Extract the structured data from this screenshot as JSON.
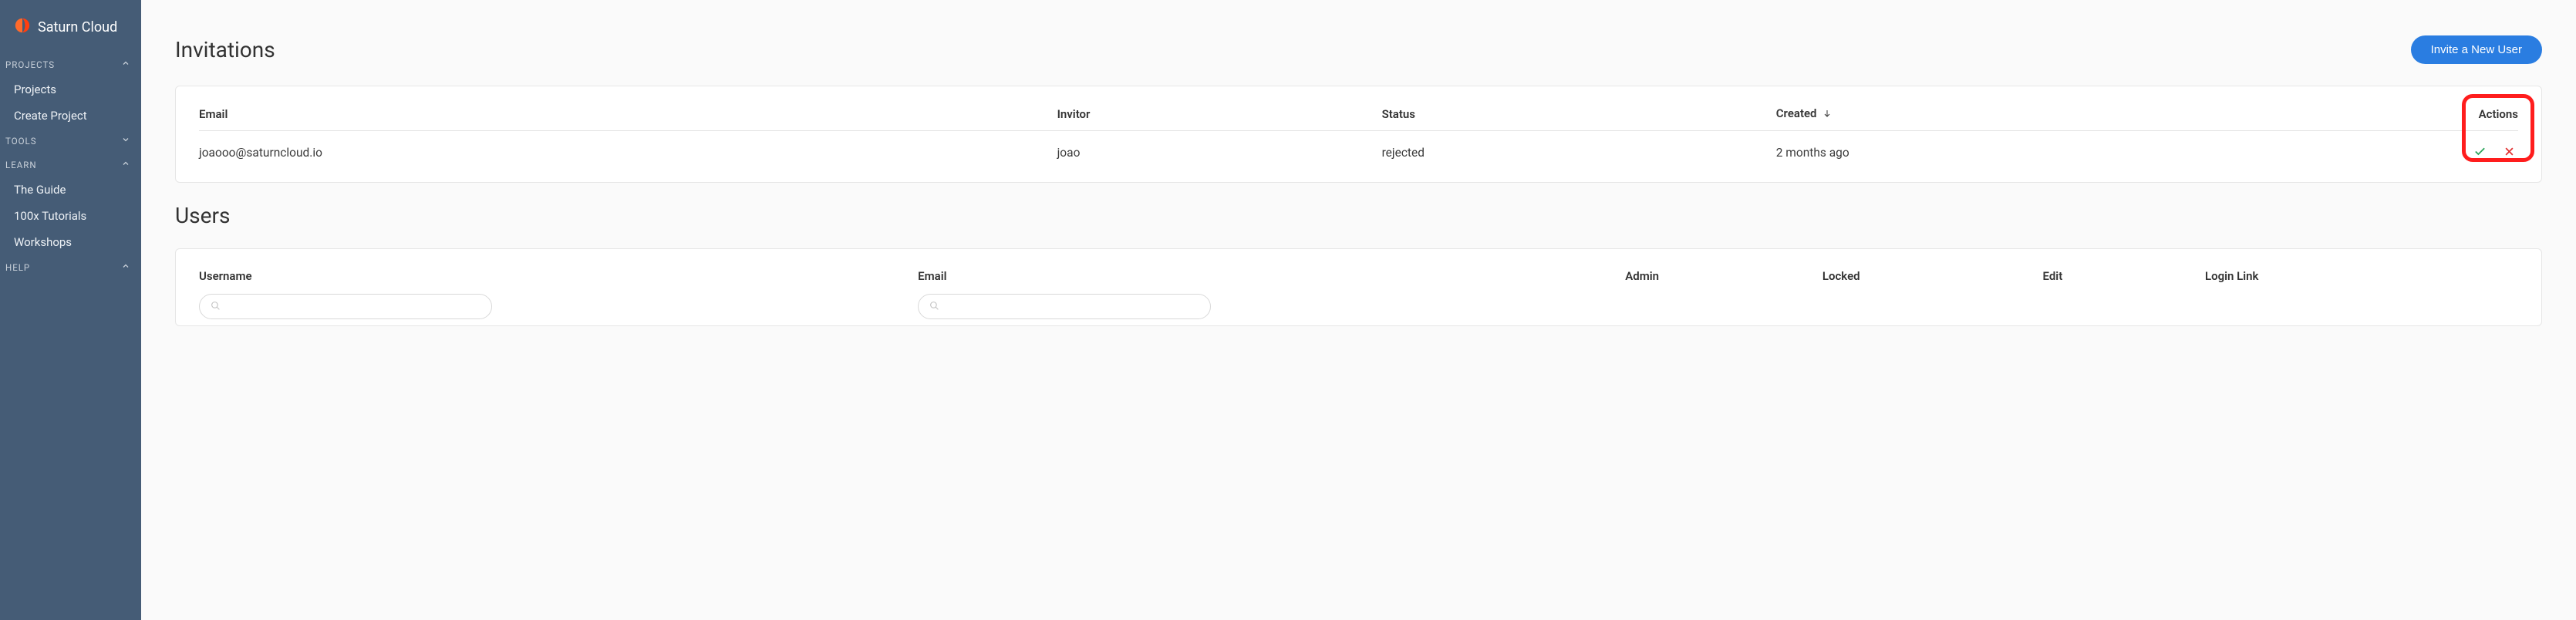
{
  "brand": {
    "name": "Saturn Cloud"
  },
  "sidebar": {
    "sections": [
      {
        "label": "PROJECTS",
        "expanded": true,
        "items": [
          {
            "label": "Projects"
          },
          {
            "label": "Create Project"
          }
        ]
      },
      {
        "label": "TOOLS",
        "expanded": false,
        "items": []
      },
      {
        "label": "LEARN",
        "expanded": true,
        "items": [
          {
            "label": "The Guide"
          },
          {
            "label": "100x Tutorials"
          },
          {
            "label": "Workshops"
          }
        ]
      },
      {
        "label": "HELP",
        "expanded": true,
        "items": []
      }
    ]
  },
  "invitations": {
    "title": "Invitations",
    "invite_button": "Invite a New User",
    "headers": {
      "email": "Email",
      "invitor": "Invitor",
      "status": "Status",
      "created": "Created",
      "actions": "Actions"
    },
    "sort": {
      "column": "created",
      "direction": "desc"
    },
    "rows": [
      {
        "email": "joaooo@saturncloud.io",
        "invitor": "joao",
        "status": "rejected",
        "created": "2 months ago"
      }
    ]
  },
  "users": {
    "title": "Users",
    "headers": {
      "username": "Username",
      "email": "Email",
      "admin": "Admin",
      "locked": "Locked",
      "edit": "Edit",
      "login_link": "Login Link"
    },
    "filters": {
      "username_placeholder": "",
      "email_placeholder": ""
    }
  }
}
